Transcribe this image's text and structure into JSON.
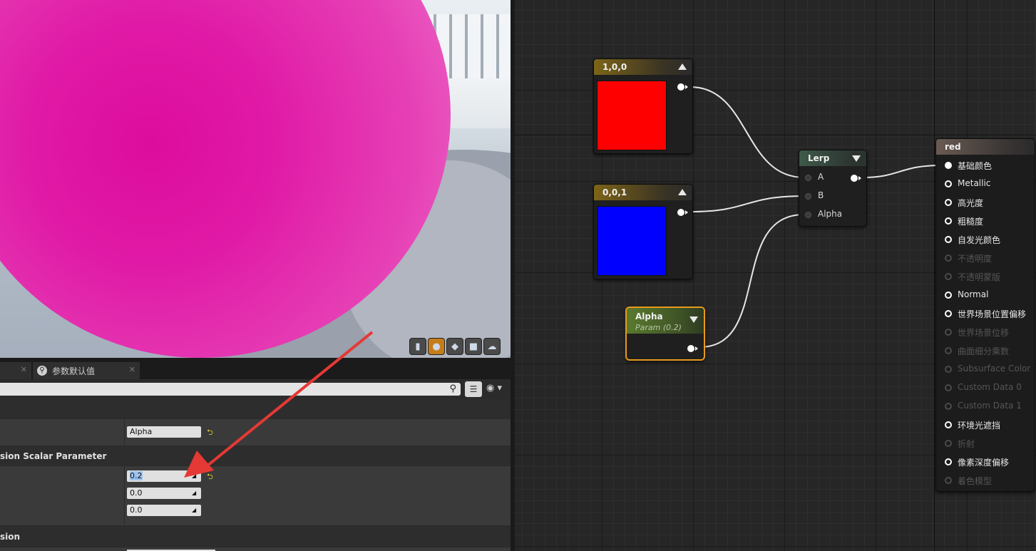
{
  "viewport": {
    "preview_color": "#e01aa6",
    "buttons": [
      {
        "icon": "cylinder-icon",
        "glyph": "▮",
        "active": false
      },
      {
        "icon": "sphere-icon",
        "glyph": "●",
        "active": true
      },
      {
        "icon": "plane-icon",
        "glyph": "◆",
        "active": false
      },
      {
        "icon": "cube-icon",
        "glyph": "■",
        "active": false
      },
      {
        "icon": "teapot-icon",
        "glyph": "☁",
        "active": false
      }
    ]
  },
  "details": {
    "tabs": [
      {
        "label": "",
        "close": "✕"
      },
      {
        "label": "参数默认值",
        "close": "✕"
      }
    ],
    "search_placeholder": "",
    "rows": {
      "param_name_value": "Alpha",
      "category_scalar": "sion Scalar Parameter",
      "default_value": "0.2",
      "slider_min": "0.0",
      "slider_max": "0.0",
      "category_expression": "sion"
    }
  },
  "graph": {
    "nodes": {
      "const_red": {
        "title": "1,0,0",
        "swatch": "#ff0000",
        "header_color": "#8b7020"
      },
      "const_blue": {
        "title": "0,0,1",
        "swatch": "#0000ff",
        "header_color": "#8b7020"
      },
      "lerp": {
        "title": "Lerp",
        "inputs": [
          "A",
          "B",
          "Alpha"
        ]
      },
      "alpha_param": {
        "title": "Alpha",
        "subtitle": "Param (0.2)",
        "selected_color": "#e89a1a"
      },
      "material": {
        "title": "red",
        "pins": [
          {
            "label": "基础颜色",
            "state": "filled"
          },
          {
            "label": "Metallic",
            "state": "on"
          },
          {
            "label": "高光度",
            "state": "on"
          },
          {
            "label": "粗糙度",
            "state": "on"
          },
          {
            "label": "自发光颜色",
            "state": "on"
          },
          {
            "label": "不透明度",
            "state": "dim"
          },
          {
            "label": "不透明蒙版",
            "state": "dim"
          },
          {
            "label": "Normal",
            "state": "on"
          },
          {
            "label": "世界场景位置偏移",
            "state": "on"
          },
          {
            "label": "世界场景位移",
            "state": "dim"
          },
          {
            "label": "曲面细分乘数",
            "state": "dim"
          },
          {
            "label": "Subsurface Color",
            "state": "dim"
          },
          {
            "label": "Custom Data 0",
            "state": "dim"
          },
          {
            "label": "Custom Data 1",
            "state": "dim"
          },
          {
            "label": "环境光遮挡",
            "state": "on"
          },
          {
            "label": "折射",
            "state": "dim"
          },
          {
            "label": "像素深度偏移",
            "state": "on"
          },
          {
            "label": "着色模型",
            "state": "dim"
          }
        ]
      }
    }
  },
  "annotation": {
    "arrow_color": "#e53935"
  }
}
